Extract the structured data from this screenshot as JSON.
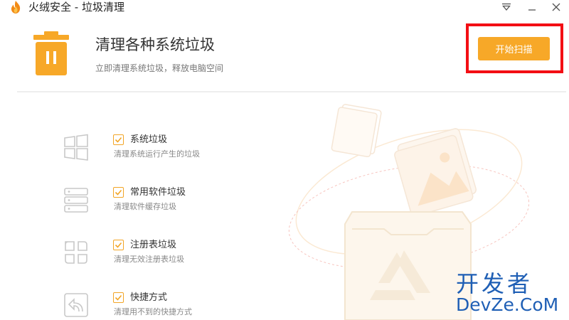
{
  "window": {
    "title": "火绒安全 - 垃圾清理",
    "icons": [
      "fire-logo-icon",
      "dropdown-menu-icon",
      "minimize-icon",
      "close-icon"
    ]
  },
  "header": {
    "title": "清理各种系统垃圾",
    "subtitle": "立即清理系统垃圾，释放电脑空间",
    "icon": "trash-can-icon",
    "scan_button": "开始扫描"
  },
  "items": [
    {
      "label": "系统垃圾",
      "desc": "清理系统运行产生的垃圾",
      "checked": true,
      "icon": "windows-icon"
    },
    {
      "label": "常用软件垃圾",
      "desc": "清理软件缓存垃圾",
      "checked": true,
      "icon": "server-icon"
    },
    {
      "label": "注册表垃圾",
      "desc": "清理无效注册表垃圾",
      "checked": true,
      "icon": "registry-grid-icon"
    },
    {
      "label": "快捷方式",
      "desc": "清理用不到的快捷方式",
      "checked": true,
      "icon": "shortcut-icon"
    }
  ],
  "watermark": {
    "cn": "开发者",
    "en": "DevZe.CoM"
  },
  "colors": {
    "accent": "#f7a828",
    "highlight": "#f30e14",
    "watermark": "#1f5fb5"
  }
}
